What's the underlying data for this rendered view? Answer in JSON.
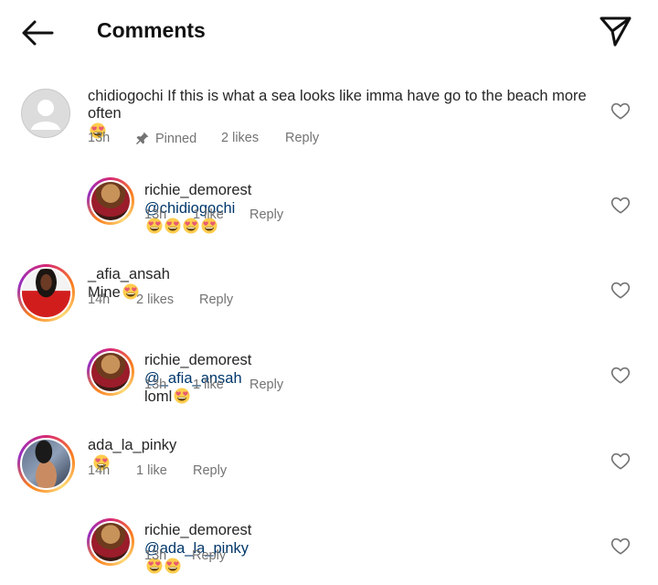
{
  "header": {
    "title": "Comments",
    "back_icon": "arrow-left-icon",
    "share_icon": "paper-plane-icon"
  },
  "comments": [
    {
      "username": "chidiogochi",
      "text": "If this is what a sea looks like imma have go to the beach more",
      "text_line2": "often",
      "emojis": 1,
      "time": "13h",
      "pinned": "Pinned",
      "likes": "2 likes",
      "reply": "Reply"
    },
    {
      "username": "richie_demorest",
      "mention": "@chidiogochi",
      "text": "",
      "emojis": 4,
      "time": "13h",
      "likes": "1 like",
      "reply": "Reply"
    },
    {
      "username": "_afia_ansah",
      "text": "Mine",
      "emojis": 1,
      "time": "14h",
      "likes": "2 likes",
      "reply": "Reply"
    },
    {
      "username": "richie_demorest",
      "mention": "@_afia_ansah",
      "text": "loml",
      "emojis": 1,
      "time": "13h",
      "likes": "1 like",
      "reply": "Reply"
    },
    {
      "username": "ada_la_pinky",
      "text": "",
      "emojis": 1,
      "time": "14h",
      "likes": "1 like",
      "reply": "Reply"
    },
    {
      "username": "richie_demorest",
      "mention": "@ada_la_pinky",
      "text": "",
      "emojis": 2,
      "time": "13h",
      "reply": "Reply"
    }
  ],
  "colors": {
    "text": "#262626",
    "meta": "#737373",
    "mention": "#00376b",
    "story_ring_start": "#d62976",
    "story_ring_end": "#fa7e1e"
  }
}
